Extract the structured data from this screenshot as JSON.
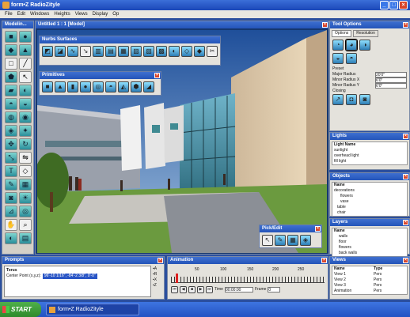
{
  "app": {
    "title": "form•Z RadioZityle"
  },
  "window_buttons": [
    "_",
    "□",
    "×"
  ],
  "menu": [
    "File",
    "Edit",
    "Windows",
    "Heights",
    "Views",
    "Display",
    "Op"
  ],
  "toolbox": {
    "title": "Modelin..."
  },
  "view_window": {
    "title": "Untitled 1 : 1 [Model]"
  },
  "nurbs_palette": {
    "title": "Nurbs Surfaces"
  },
  "primitives_palette": {
    "title": "Primitives"
  },
  "pick_palette": {
    "title": "Pick/Edit"
  },
  "tool_options": {
    "title": "Tool Options",
    "tabs": [
      "Options",
      "Resolution"
    ],
    "fields": [
      {
        "label": "Preset",
        "value": ""
      },
      {
        "label": "Major Radius",
        "value": "20'0\""
      },
      {
        "label": "Minor Radius X",
        "value": "6'0\""
      },
      {
        "label": "Minor Radius Y",
        "value": "6'0\""
      }
    ],
    "closing_label": "Closing"
  },
  "lights": {
    "title": "Lights",
    "header": "Light Name",
    "items": [
      "sunlight",
      "overhead light",
      "fill light"
    ]
  },
  "objects": {
    "title": "Objects",
    "header": "Name",
    "items": [
      "decorations",
      "flowers",
      "vase",
      "table",
      "chair"
    ]
  },
  "layers": {
    "title": "Layers",
    "header": "Name",
    "items": [
      "walls",
      "floor",
      "flowers",
      "back walls"
    ]
  },
  "prompts": {
    "title": "Prompts",
    "line1": "Torus",
    "line2_label": "Center Point (x,y,z):",
    "line2_value": "96'-10 1/16\", -84'-2 3/8\", 0'-0\""
  },
  "animation": {
    "title": "Animation",
    "ticks": [
      "50",
      "100",
      "150",
      "200",
      "250"
    ],
    "time_label": "Time",
    "time_value": "00:00:00",
    "frame_label": "Frame",
    "frame_value": "0"
  },
  "views": {
    "title": "Views",
    "header": [
      "Name",
      "Type"
    ],
    "items": [
      {
        "name": "View 1",
        "type": "Pers"
      },
      {
        "name": "View 2",
        "type": "Pers"
      },
      {
        "name": "View 3",
        "type": "Pers"
      },
      {
        "name": "Animation",
        "type": "Pers"
      }
    ]
  },
  "taskbar": {
    "start": "START",
    "task": "form•Z RadioZityle"
  }
}
